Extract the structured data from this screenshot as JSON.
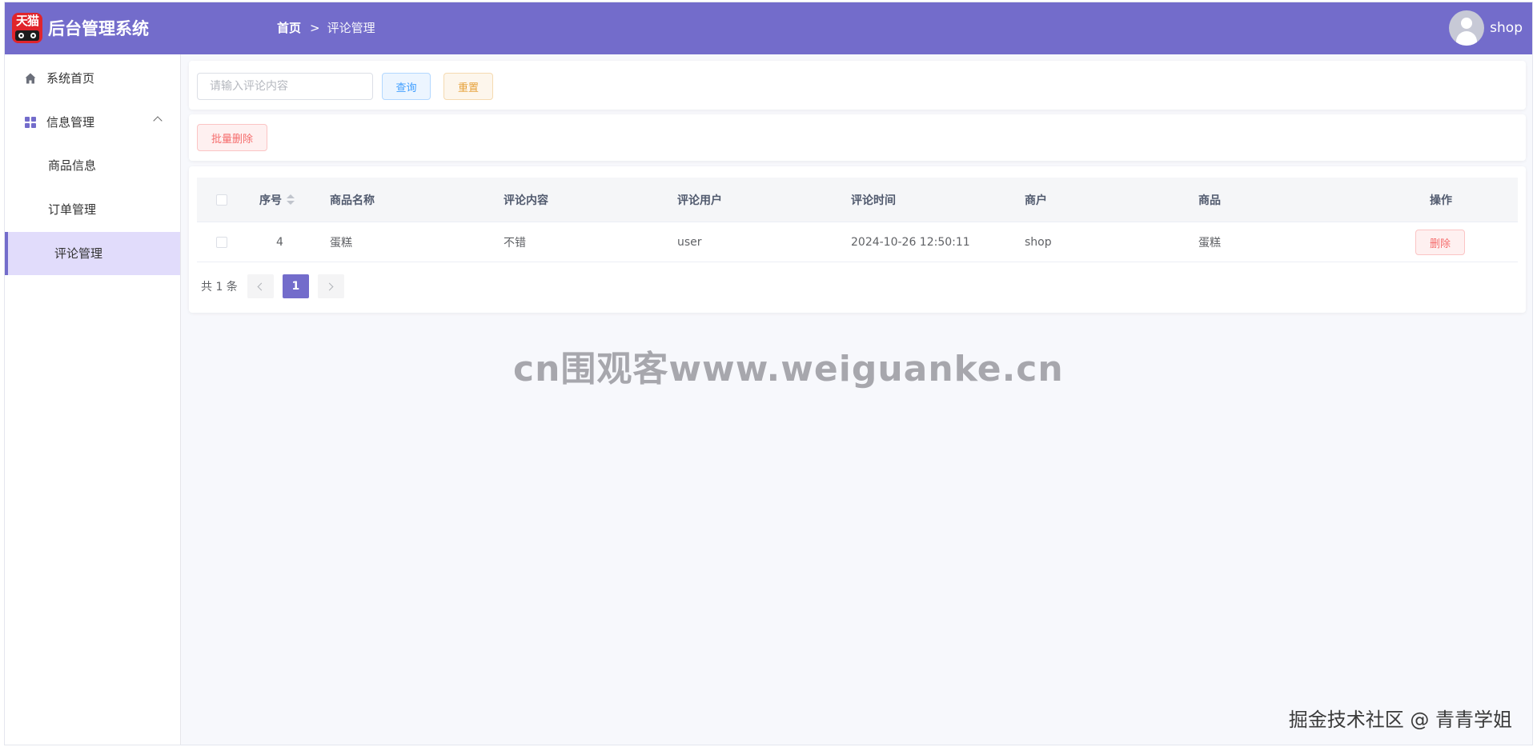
{
  "logo": {
    "text": "天猫"
  },
  "header": {
    "app_title": "后台管理系统",
    "breadcrumb": {
      "home": "首页",
      "separator": ">",
      "current": "评论管理"
    },
    "user": {
      "name": "shop"
    }
  },
  "sidebar": {
    "items": [
      {
        "label": "系统首页",
        "icon": "home-icon"
      },
      {
        "label": "信息管理",
        "icon": "grid-icon",
        "expanded": true
      },
      {
        "label": "商品信息"
      },
      {
        "label": "订单管理"
      },
      {
        "label": "评论管理",
        "active": true
      }
    ]
  },
  "search": {
    "placeholder": "请输入评论内容",
    "value": "",
    "query_label": "查询",
    "reset_label": "重置"
  },
  "actions": {
    "batch_delete_label": "批量删除"
  },
  "table": {
    "columns": [
      "序号",
      "商品名称",
      "评论内容",
      "评论用户",
      "评论时间",
      "商户",
      "商品",
      "操作"
    ],
    "rows": [
      {
        "index": "4",
        "product_name": "蛋糕",
        "content": "不错",
        "user": "user",
        "time": "2024-10-26 12:50:11",
        "merchant": "shop",
        "product": "蛋糕",
        "delete_label": "删除"
      }
    ]
  },
  "pagination": {
    "total_text": "共 1 条",
    "current_page": "1"
  },
  "watermarks": {
    "center": "cn围观客www.weiguanke.cn",
    "corner": "掘金技术社区 @ 青青学姐"
  },
  "colors": {
    "header_bg": "#736ccb",
    "active_menu_bg": "#e1dcfb",
    "query_button": "#409eff",
    "reset_button": "#e6a23c",
    "danger": "#f56c6c",
    "page_active": "#736ccb"
  }
}
